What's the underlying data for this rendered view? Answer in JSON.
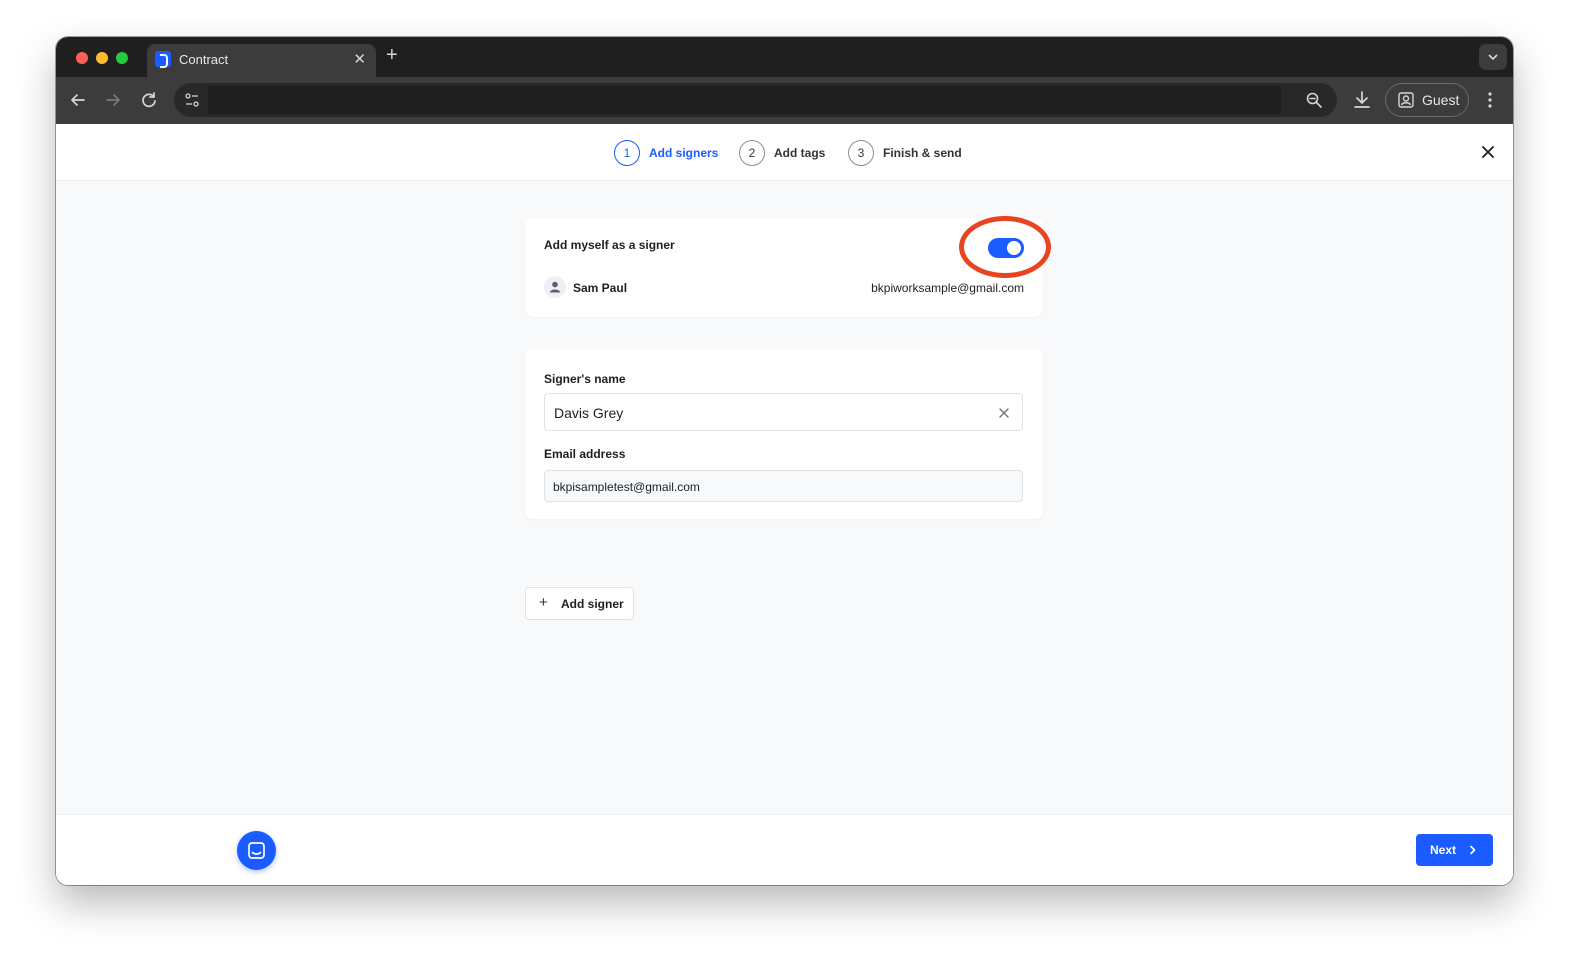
{
  "browser": {
    "tab_title": "Contract",
    "tab_close": "✕",
    "new_tab": "+",
    "tab_menu": "⌄",
    "address": "",
    "profile_label": "Guest"
  },
  "steps": [
    {
      "number": "1",
      "label": "Add signers",
      "active": true
    },
    {
      "number": "2",
      "label": "Add tags",
      "active": false
    },
    {
      "number": "3",
      "label": "Finish & send",
      "active": false
    }
  ],
  "self_signer": {
    "title": "Add myself as a signer",
    "toggle_on": true,
    "name": "Sam Paul",
    "email": "bkpiworksample@gmail.com"
  },
  "signer": {
    "name_label": "Signer's name",
    "name_value": "Davis Grey",
    "email_label": "Email address",
    "email_value": "bkpisampletest@gmail.com"
  },
  "add_signer": {
    "icon": "+",
    "label": "Add signer"
  },
  "footer": {
    "next_label": "Next"
  },
  "colors": {
    "accent": "#1a5cff",
    "highlight": "#e8441f"
  }
}
